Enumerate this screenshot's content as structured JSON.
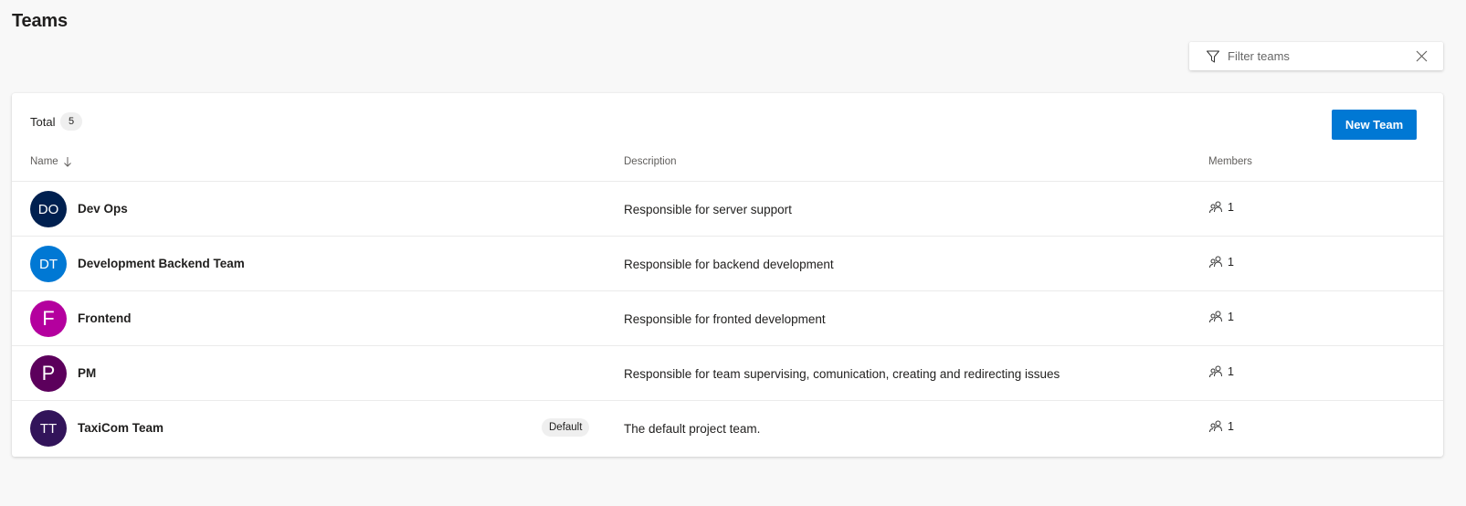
{
  "page": {
    "title": "Teams"
  },
  "filter": {
    "placeholder": "Filter teams",
    "value": ""
  },
  "summary": {
    "total_label": "Total",
    "total_count": "5"
  },
  "actions": {
    "new_team_label": "New Team"
  },
  "columns": {
    "name": "Name",
    "description": "Description",
    "members": "Members"
  },
  "colors": {
    "accent": "#0078d4"
  },
  "teams": [
    {
      "initials": "DO",
      "name": "Dev Ops",
      "description": "Responsible for server support",
      "members": "1",
      "avatar_color": "#002050",
      "badge": ""
    },
    {
      "initials": "DT",
      "name": "Development Backend Team",
      "description": "Responsible for backend development",
      "members": "1",
      "avatar_color": "#0078d4",
      "badge": ""
    },
    {
      "initials": "F",
      "name": "Frontend",
      "description": "Responsible for fronted development",
      "members": "1",
      "avatar_color": "#b4009e",
      "badge": ""
    },
    {
      "initials": "P",
      "name": "PM",
      "description": "Responsible for team supervising, comunication, creating and redirecting issues",
      "members": "1",
      "avatar_color": "#5c005c",
      "badge": ""
    },
    {
      "initials": "TT",
      "name": "TaxiCom Team",
      "description": "The default project team.",
      "members": "1",
      "avatar_color": "#32145a",
      "badge": "Default"
    }
  ]
}
